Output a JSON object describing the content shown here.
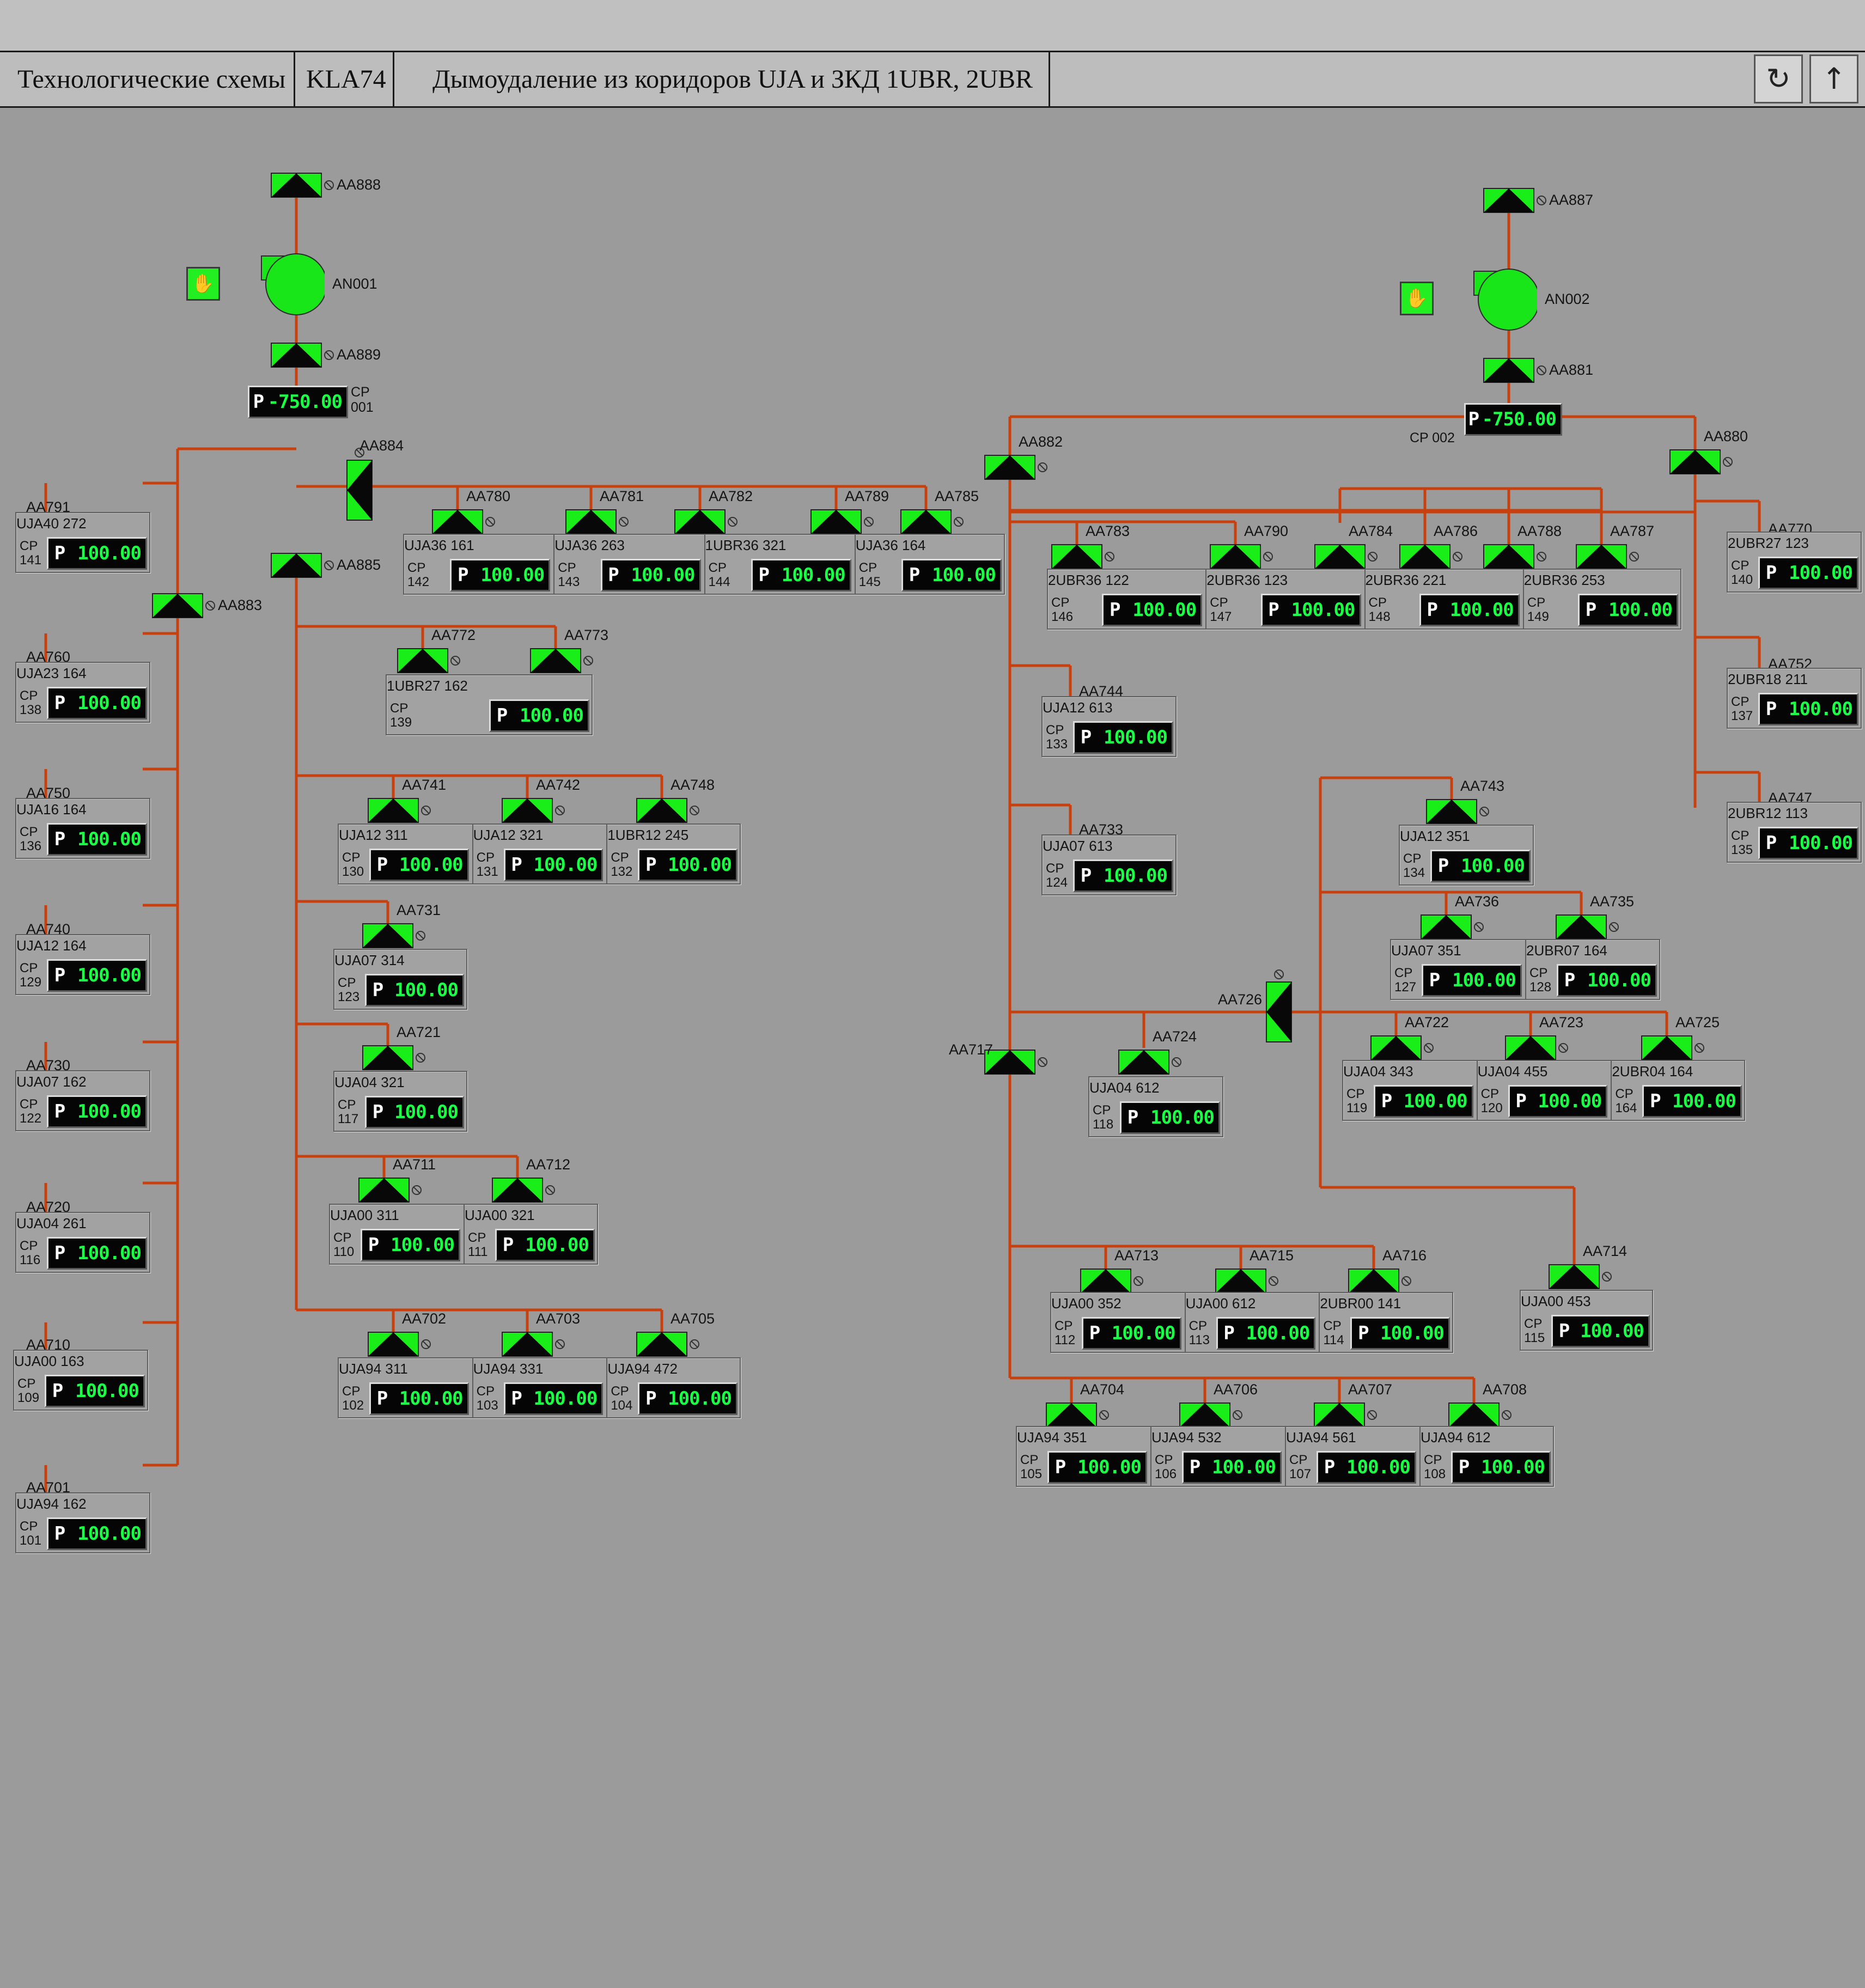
{
  "header": {
    "section": "Технологические схемы",
    "code": "KLA74",
    "title": "Дымоудаление из коридоров UJA и ЗКД 1UBR, 2UBR",
    "refresh_icon": "refresh-icon",
    "up_icon": "arrow-up-icon"
  },
  "colors": {
    "background": "#9b9b9b",
    "pipe": "#c8400e",
    "active": "#19ee19",
    "value": "#19ff45"
  },
  "fans": [
    {
      "id": "fan-an001",
      "label": "AN001",
      "state": "running",
      "mode_icon": "hand-icon"
    },
    {
      "id": "fan-an002",
      "label": "AN002",
      "state": "running",
      "mode_icon": "hand-icon"
    }
  ],
  "dampers": [
    {
      "id": "aa888",
      "label": "AA888"
    },
    {
      "id": "aa889",
      "label": "AA889"
    },
    {
      "id": "aa884",
      "label": "AA884"
    },
    {
      "id": "aa885",
      "label": "AA885"
    },
    {
      "id": "aa883",
      "label": "AA883"
    },
    {
      "id": "aa887",
      "label": "AA887"
    },
    {
      "id": "aa881",
      "label": "AA881"
    },
    {
      "id": "aa882",
      "label": "AA882"
    },
    {
      "id": "aa880",
      "label": "AA880"
    },
    {
      "id": "aa726",
      "label": "AA726"
    },
    {
      "id": "aa717",
      "label": "AA717"
    },
    {
      "id": "aa791",
      "label": "AA791"
    },
    {
      "id": "aa760",
      "label": "AA760"
    },
    {
      "id": "aa750",
      "label": "AA750"
    },
    {
      "id": "aa740",
      "label": "AA740"
    },
    {
      "id": "aa730",
      "label": "AA730"
    },
    {
      "id": "aa720",
      "label": "AA720"
    },
    {
      "id": "aa710",
      "label": "AA710"
    },
    {
      "id": "aa701",
      "label": "AA701"
    },
    {
      "id": "aa780",
      "label": "AA780"
    },
    {
      "id": "aa781",
      "label": "AA781"
    },
    {
      "id": "aa782",
      "label": "AA782"
    },
    {
      "id": "aa789",
      "label": "AA789"
    },
    {
      "id": "aa785",
      "label": "AA785"
    },
    {
      "id": "aa772",
      "label": "AA772"
    },
    {
      "id": "aa773",
      "label": "AA773"
    },
    {
      "id": "aa741",
      "label": "AA741"
    },
    {
      "id": "aa742",
      "label": "AA742"
    },
    {
      "id": "aa748",
      "label": "AA748"
    },
    {
      "id": "aa731",
      "label": "AA731"
    },
    {
      "id": "aa721",
      "label": "AA721"
    },
    {
      "id": "aa711",
      "label": "AA711"
    },
    {
      "id": "aa712",
      "label": "AA712"
    },
    {
      "id": "aa702",
      "label": "AA702"
    },
    {
      "id": "aa703",
      "label": "AA703"
    },
    {
      "id": "aa705",
      "label": "AA705"
    },
    {
      "id": "aa783",
      "label": "AA783"
    },
    {
      "id": "aa790",
      "label": "AA790"
    },
    {
      "id": "aa784",
      "label": "AA784"
    },
    {
      "id": "aa786",
      "label": "AA786"
    },
    {
      "id": "aa788",
      "label": "AA788"
    },
    {
      "id": "aa787",
      "label": "AA787"
    },
    {
      "id": "aa770",
      "label": "AA770"
    },
    {
      "id": "aa752",
      "label": "AA752"
    },
    {
      "id": "aa747",
      "label": "AA747"
    },
    {
      "id": "aa744",
      "label": "AA744"
    },
    {
      "id": "aa733",
      "label": "AA733"
    },
    {
      "id": "aa743",
      "label": "AA743"
    },
    {
      "id": "aa736",
      "label": "AA736"
    },
    {
      "id": "aa735",
      "label": "AA735"
    },
    {
      "id": "aa722",
      "label": "AA722"
    },
    {
      "id": "aa723",
      "label": "AA723"
    },
    {
      "id": "aa725",
      "label": "AA725"
    },
    {
      "id": "aa724",
      "label": "AA724"
    },
    {
      "id": "aa713",
      "label": "AA713"
    },
    {
      "id": "aa715",
      "label": "AA715"
    },
    {
      "id": "aa716",
      "label": "AA716"
    },
    {
      "id": "aa714",
      "label": "AA714"
    },
    {
      "id": "aa704",
      "label": "AA704"
    },
    {
      "id": "aa706",
      "label": "AA706"
    },
    {
      "id": "aa707",
      "label": "AA707"
    },
    {
      "id": "aa708",
      "label": "AA708"
    }
  ],
  "main_sensors": [
    {
      "id": "cp001",
      "cp": "CP",
      "num": "001",
      "unit": "P",
      "value": "-750.00"
    },
    {
      "id": "cp002",
      "cp": "CP 002",
      "unit": "P",
      "value": "-750.00"
    }
  ],
  "sensor_groups": [
    {
      "id": "g-141",
      "cells": [
        {
          "label": "UJA40 272",
          "cp": "CP",
          "num": "141",
          "unit": "P",
          "value": "100.00"
        }
      ]
    },
    {
      "id": "g-138",
      "cells": [
        {
          "label": "UJA23 164",
          "cp": "CP",
          "num": "138",
          "unit": "P",
          "value": "100.00"
        }
      ]
    },
    {
      "id": "g-136",
      "cells": [
        {
          "label": "UJA16 164",
          "cp": "CP",
          "num": "136",
          "unit": "P",
          "value": "100.00"
        }
      ]
    },
    {
      "id": "g-129",
      "cells": [
        {
          "label": "UJA12 164",
          "cp": "CP",
          "num": "129",
          "unit": "P",
          "value": "100.00"
        }
      ]
    },
    {
      "id": "g-122",
      "cells": [
        {
          "label": "UJA07 162",
          "cp": "CP",
          "num": "122",
          "unit": "P",
          "value": "100.00"
        }
      ]
    },
    {
      "id": "g-116",
      "cells": [
        {
          "label": "UJA04 261",
          "cp": "CP",
          "num": "116",
          "unit": "P",
          "value": "100.00"
        }
      ]
    },
    {
      "id": "g-109",
      "cells": [
        {
          "label": "UJA00 163",
          "cp": "CP",
          "num": "109",
          "unit": "P",
          "value": "100.00"
        }
      ]
    },
    {
      "id": "g-101",
      "cells": [
        {
          "label": "UJA94 162",
          "cp": "CP",
          "num": "101",
          "unit": "P",
          "value": "100.00"
        }
      ]
    },
    {
      "id": "g-142",
      "cells": [
        {
          "label": "UJA36 161",
          "cp": "CP",
          "num": "142",
          "unit": "P",
          "value": "100.00"
        },
        {
          "label": "UJA36 263",
          "cp": "CP",
          "num": "143",
          "unit": "P",
          "value": "100.00"
        },
        {
          "label": "1UBR36 321",
          "cp": "CP",
          "num": "144",
          "unit": "P",
          "value": "100.00"
        },
        {
          "label": "UJA36 164",
          "cp": "CP",
          "num": "145",
          "unit": "P",
          "value": "100.00"
        }
      ]
    },
    {
      "id": "g-139",
      "cells": [
        {
          "label": "1UBR27 162",
          "cp": "CP",
          "num": "139",
          "unit": "P",
          "value": "100.00"
        }
      ]
    },
    {
      "id": "g-130",
      "cells": [
        {
          "label": "UJA12 311",
          "cp": "CP",
          "num": "130",
          "unit": "P",
          "value": "100.00"
        },
        {
          "label": "UJA12 321",
          "cp": "CP",
          "num": "131",
          "unit": "P",
          "value": "100.00"
        },
        {
          "label": "1UBR12 245",
          "cp": "CP",
          "num": "132",
          "unit": "P",
          "value": "100.00"
        }
      ]
    },
    {
      "id": "g-123",
      "cells": [
        {
          "label": "UJA07 314",
          "cp": "CP",
          "num": "123",
          "unit": "P",
          "value": "100.00"
        }
      ]
    },
    {
      "id": "g-117",
      "cells": [
        {
          "label": "UJA04 321",
          "cp": "CP",
          "num": "117",
          "unit": "P",
          "value": "100.00"
        }
      ]
    },
    {
      "id": "g-110",
      "cells": [
        {
          "label": "UJA00 311",
          "cp": "CP",
          "num": "110",
          "unit": "P",
          "value": "100.00"
        },
        {
          "label": "UJA00 321",
          "cp": "CP",
          "num": "111",
          "unit": "P",
          "value": "100.00"
        }
      ]
    },
    {
      "id": "g-102",
      "cells": [
        {
          "label": "UJA94 311",
          "cp": "CP",
          "num": "102",
          "unit": "P",
          "value": "100.00"
        },
        {
          "label": "UJA94 331",
          "cp": "CP",
          "num": "103",
          "unit": "P",
          "value": "100.00"
        },
        {
          "label": "UJA94 472",
          "cp": "CP",
          "num": "104",
          "unit": "P",
          "value": "100.00"
        }
      ]
    },
    {
      "id": "g-146",
      "cells": [
        {
          "label": "2UBR36 122",
          "cp": "CP",
          "num": "146",
          "unit": "P",
          "value": "100.00"
        },
        {
          "label": "2UBR36 123",
          "cp": "CP",
          "num": "147",
          "unit": "P",
          "value": "100.00"
        },
        {
          "label": "2UBR36 221",
          "cp": "CP",
          "num": "148",
          "unit": "P",
          "value": "100.00"
        },
        {
          "label": "2UBR36 253",
          "cp": "CP",
          "num": "149",
          "unit": "P",
          "value": "100.00"
        }
      ]
    },
    {
      "id": "g-140",
      "cells": [
        {
          "label": "2UBR27 123",
          "cp": "CP",
          "num": "140",
          "unit": "P",
          "value": "100.00"
        }
      ]
    },
    {
      "id": "g-137",
      "cells": [
        {
          "label": "2UBR18 211",
          "cp": "CP",
          "num": "137",
          "unit": "P",
          "value": "100.00"
        }
      ]
    },
    {
      "id": "g-135",
      "cells": [
        {
          "label": "2UBR12 113",
          "cp": "CP",
          "num": "135",
          "unit": "P",
          "value": "100.00"
        }
      ]
    },
    {
      "id": "g-133",
      "cells": [
        {
          "label": "UJA12 613",
          "cp": "CP",
          "num": "133",
          "unit": "P",
          "value": "100.00"
        }
      ]
    },
    {
      "id": "g-124",
      "cells": [
        {
          "label": "UJA07 613",
          "cp": "CP",
          "num": "124",
          "unit": "P",
          "value": "100.00"
        }
      ]
    },
    {
      "id": "g-134",
      "cells": [
        {
          "label": "UJA12 351",
          "cp": "CP",
          "num": "134",
          "unit": "P",
          "value": "100.00"
        }
      ]
    },
    {
      "id": "g-127",
      "cells": [
        {
          "label": "UJA07 351",
          "cp": "CP",
          "num": "127",
          "unit": "P",
          "value": "100.00"
        },
        {
          "label": "2UBR07 164",
          "cp": "CP",
          "num": "128",
          "unit": "P",
          "value": "100.00"
        }
      ]
    },
    {
      "id": "g-119",
      "cells": [
        {
          "label": "UJA04 343",
          "cp": "CP",
          "num": "119",
          "unit": "P",
          "value": "100.00"
        },
        {
          "label": "UJA04 455",
          "cp": "CP",
          "num": "120",
          "unit": "P",
          "value": "100.00"
        },
        {
          "label": "2UBR04 164",
          "cp": "CP",
          "num": "164",
          "unit": "P",
          "value": "100.00"
        }
      ]
    },
    {
      "id": "g-118",
      "cells": [
        {
          "label": "UJA04 612",
          "cp": "CP",
          "num": "118",
          "unit": "P",
          "value": "100.00"
        }
      ]
    },
    {
      "id": "g-112",
      "cells": [
        {
          "label": "UJA00 352",
          "cp": "CP",
          "num": "112",
          "unit": "P",
          "value": "100.00"
        },
        {
          "label": "UJA00 612",
          "cp": "CP",
          "num": "113",
          "unit": "P",
          "value": "100.00"
        },
        {
          "label": "2UBR00 141",
          "cp": "CP",
          "num": "114",
          "unit": "P",
          "value": "100.00"
        }
      ]
    },
    {
      "id": "g-115",
      "cells": [
        {
          "label": "UJA00 453",
          "cp": "CP",
          "num": "115",
          "unit": "P",
          "value": "100.00"
        }
      ]
    },
    {
      "id": "g-105",
      "cells": [
        {
          "label": "UJA94 351",
          "cp": "CP",
          "num": "105",
          "unit": "P",
          "value": "100.00"
        },
        {
          "label": "UJA94 532",
          "cp": "CP",
          "num": "106",
          "unit": "P",
          "value": "100.00"
        },
        {
          "label": "UJA94 561",
          "cp": "CP",
          "num": "107",
          "unit": "P",
          "value": "100.00"
        },
        {
          "label": "UJA94 612",
          "cp": "CP",
          "num": "108",
          "unit": "P",
          "value": "100.00"
        }
      ]
    }
  ]
}
